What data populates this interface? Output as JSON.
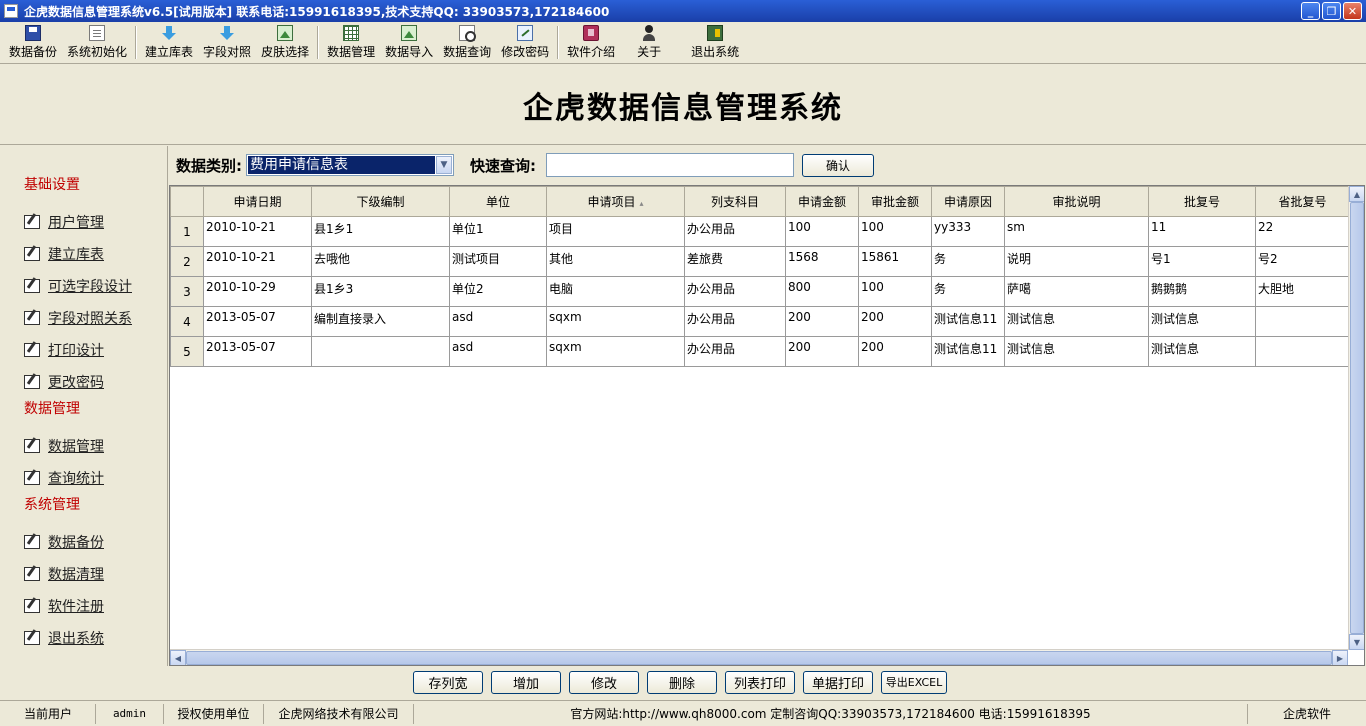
{
  "window": {
    "title": "企虎数据信息管理系统v6.5[试用版本]   联系电话:15991618395,技术支持QQ: 33903573,172184600",
    "controls": [
      "minimize",
      "maximize",
      "close"
    ]
  },
  "toolbar": {
    "items": [
      {
        "label": "数据备份",
        "icon": "save-icon"
      },
      {
        "label": "系统初始化",
        "icon": "document-icon"
      },
      {
        "label": "建立库表",
        "icon": "arrow-down-icon"
      },
      {
        "label": "字段对照",
        "icon": "arrow-down-icon"
      },
      {
        "label": "皮肤选择",
        "icon": "picture-icon"
      },
      {
        "label": "数据管理",
        "icon": "grid-icon"
      },
      {
        "label": "数据导入",
        "icon": "picture-icon"
      },
      {
        "label": "数据查询",
        "icon": "magnify-icon"
      },
      {
        "label": "修改密码",
        "icon": "key-icon"
      },
      {
        "label": "软件介绍",
        "icon": "book-icon"
      },
      {
        "label": "关于",
        "icon": "person-icon"
      },
      {
        "label": "退出系统",
        "icon": "exit-icon"
      }
    ]
  },
  "banner": {
    "heading": "企虎数据信息管理系统"
  },
  "sidebar": {
    "groups": [
      {
        "title": "基础设置",
        "items": [
          "用户管理",
          "建立库表",
          "可选字段设计",
          "字段对照关系",
          "打印设计",
          "更改密码"
        ]
      },
      {
        "title": "数据管理",
        "items": [
          "数据管理",
          "查询统计"
        ]
      },
      {
        "title": "系统管理",
        "items": [
          "数据备份",
          "数据清理",
          "软件注册",
          "退出系统"
        ]
      }
    ]
  },
  "filter": {
    "category_label": "数据类别:",
    "category_value": "费用申请信息表",
    "search_label": "快速查询:",
    "search_value": "",
    "confirm_label": "确认"
  },
  "table": {
    "columns": [
      "申请日期",
      "下级编制",
      "单位",
      "申请项目",
      "列支科目",
      "申请金额",
      "审批金额",
      "申请原因",
      "审批说明",
      "批复号",
      "省批复号"
    ],
    "sorted_column_index": 3,
    "rows": [
      [
        "2010-10-21",
        "县1乡1",
        "单位1",
        "项目",
        "办公用品",
        "100",
        "100",
        "yy333",
        "sm",
        "11",
        "22"
      ],
      [
        "2010-10-21",
        "去哦他",
        "测试项目",
        "其他",
        "差旅费",
        "1568",
        "15861",
        "务",
        "说明",
        "号1",
        "号2"
      ],
      [
        "2010-10-29",
        "县1乡3",
        "单位2",
        "电脑",
        "办公用品",
        "800",
        "100",
        "务",
        "萨噶",
        "鹅鹅鹅",
        "大胆地"
      ],
      [
        "2013-05-07",
        "编制直接录入",
        "asd",
        "sqxm",
        "办公用品",
        "200",
        "200",
        "测试信息11",
        "测试信息",
        "测试信息",
        ""
      ],
      [
        "2013-05-07",
        "",
        "asd",
        "sqxm",
        "办公用品",
        "200",
        "200",
        "测试信息11",
        "测试信息",
        "测试信息",
        ""
      ]
    ]
  },
  "actions": [
    "存列宽",
    "增加",
    "修改",
    "删除",
    "列表打印",
    "单据打印",
    "导出EXCEL"
  ],
  "status": {
    "user_label": "当前用户",
    "user_value": "admin",
    "org_label": "授权使用单位",
    "org_value": "企虎网络技术有限公司",
    "contact": "官方网站:http://www.qh8000.com 定制咨询QQ:33903573,172184600 电话:15991618395",
    "brand": "企虎软件"
  }
}
